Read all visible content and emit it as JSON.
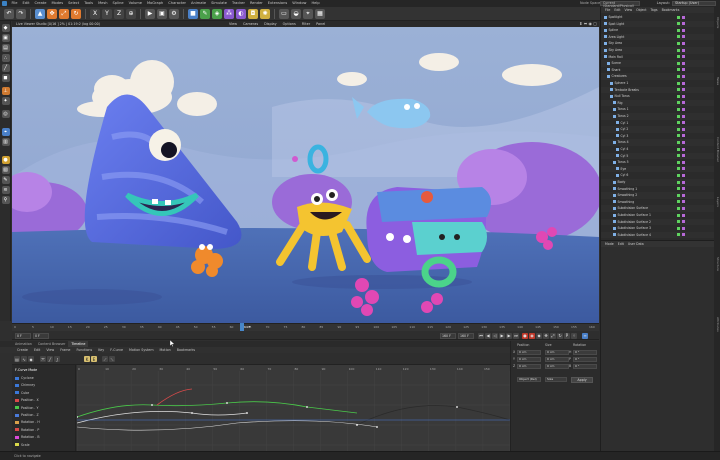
{
  "menubar": {
    "items": [
      "File",
      "Edit",
      "Create",
      "Modes",
      "Select",
      "Tools",
      "Mesh",
      "Spline",
      "Volume",
      "MoGraph",
      "Character",
      "Animate",
      "Simulate",
      "Tracker",
      "Render",
      "Extensions",
      "Window",
      "Help"
    ],
    "node_space_label": "Node Space:",
    "node_space_value": "Current (Standard/Physical)",
    "layout_label": "Layout:",
    "layout_value": "Startup (User)"
  },
  "viewport": {
    "title": "Live Viewer Studio [0/16 ] 2% | 01:19:2 (log 00:00)",
    "menu": [
      "View",
      "Cameras",
      "Display",
      "Options",
      "Filter",
      "Panel"
    ],
    "icons": "⬍ ⬌ ◉ ▢"
  },
  "ruler": {
    "ticks": [
      "0",
      "5",
      "10",
      "15",
      "20",
      "25",
      "30",
      "35",
      "40",
      "45",
      "50",
      "55",
      "60",
      "65",
      "70",
      "75",
      "80",
      "85",
      "90",
      "95",
      "100",
      "105",
      "110",
      "115",
      "120",
      "125",
      "130",
      "135",
      "140",
      "145",
      "150",
      "155",
      "160"
    ],
    "current_frame": "64 F"
  },
  "transport": {
    "start": "0 F",
    "end": "160 F",
    "range_end": "160 F",
    "current": "0 F"
  },
  "timeline": {
    "tabs": [
      "Animation",
      "Content Browser",
      "Timeline"
    ],
    "menu": [
      "Create",
      "Edit",
      "View",
      "Frame",
      "Functions",
      "Key",
      "F-Curve",
      "Motion System",
      "Motion",
      "Bookmarks"
    ],
    "mode_label": "F-Curve Mode",
    "tree": [
      {
        "label": "Cyclone",
        "color": "#3b78d8"
      },
      {
        "label": "Chimney",
        "color": "#3b78d8"
      },
      {
        "label": "Cube",
        "color": "#3b78d8"
      },
      {
        "label": "Position . X",
        "color": "#d94a4a"
      },
      {
        "label": "Position . Y",
        "color": "#4ac94a"
      },
      {
        "label": "Position . Z",
        "color": "#4a7ad9"
      },
      {
        "label": "Rotation . H",
        "color": "#d9a04a"
      },
      {
        "label": "Rotation . P",
        "color": "#d94a4a"
      },
      {
        "label": "Rotation . B",
        "color": "#d94ad9"
      },
      {
        "label": "Scale",
        "color": "#d9d94a"
      }
    ],
    "graph_ticks": [
      "0",
      "10",
      "20",
      "30",
      "40",
      "50",
      "60",
      "70",
      "80",
      "90",
      "100",
      "110",
      "120",
      "130",
      "140",
      "150",
      "160"
    ]
  },
  "status": {
    "text": "Click to navigate"
  },
  "coords": {
    "headers": [
      "Position",
      "Size",
      "Rotation"
    ],
    "rows": [
      {
        "axis": "X",
        "pos": "0 cm",
        "size": "0 cm",
        "rot_axis": "H",
        "rot": "0 °"
      },
      {
        "axis": "Y",
        "pos": "0 cm",
        "size": "0 cm",
        "rot_axis": "P",
        "rot": "0 °"
      },
      {
        "axis": "Z",
        "pos": "0 cm",
        "size": "0 cm",
        "rot_axis": "B",
        "rot": "0 °"
      }
    ],
    "mode": "Object (Rel)",
    "size_mode": "Size",
    "apply": "Apply"
  },
  "object_manager": {
    "menu": [
      "File",
      "Edit",
      "View",
      "Object",
      "Tags",
      "Bookmarks"
    ],
    "rows": [
      {
        "label": "Spotlight",
        "indent": 0
      },
      {
        "label": "Spot Light",
        "indent": 0
      },
      {
        "label": "Spline",
        "indent": 0
      },
      {
        "label": "Area Light",
        "indent": 0
      },
      {
        "label": "Sky Area",
        "indent": 0
      },
      {
        "label": "Sky Area",
        "indent": 0
      },
      {
        "label": "Main Rail",
        "indent": 0
      },
      {
        "label": "Scene",
        "indent": 1
      },
      {
        "label": "Shark",
        "indent": 1
      },
      {
        "label": "Creatures",
        "indent": 1
      },
      {
        "label": "Sphere 1",
        "indent": 2
      },
      {
        "label": "Tentacle Breaks",
        "indent": 2
      },
      {
        "label": "Null Torus",
        "indent": 2
      },
      {
        "label": "Rig",
        "indent": 3
      },
      {
        "label": "Torus 1",
        "indent": 3
      },
      {
        "label": "Torus 2",
        "indent": 3
      },
      {
        "label": "Cyl 1",
        "indent": 4
      },
      {
        "label": "Cyl 2",
        "indent": 4
      },
      {
        "label": "Cyl 3",
        "indent": 4
      },
      {
        "label": "Torus 4",
        "indent": 3
      },
      {
        "label": "Cyl 4",
        "indent": 4
      },
      {
        "label": "Cyl 5",
        "indent": 4
      },
      {
        "label": "Torus 5",
        "indent": 3
      },
      {
        "label": "Eye",
        "indent": 4
      },
      {
        "label": "Cyl 6",
        "indent": 4
      },
      {
        "label": "Body",
        "indent": 3
      },
      {
        "label": "Smoothing 1",
        "indent": 3
      },
      {
        "label": "Smoothing 2",
        "indent": 3
      },
      {
        "label": "Smoothing",
        "indent": 3
      },
      {
        "label": "Subdivision Surface",
        "indent": 3
      },
      {
        "label": "Subdivision Surface 1",
        "indent": 3
      },
      {
        "label": "Subdivision Surface 2",
        "indent": 3
      },
      {
        "label": "Subdivision Surface 3",
        "indent": 3
      },
      {
        "label": "Subdivision Surface 4",
        "indent": 3
      }
    ]
  },
  "attribute_manager": {
    "menu": [
      "Mode",
      "Edit",
      "User Data"
    ]
  },
  "side_tabs": [
    "Objects",
    "Takes",
    "Content Browser",
    "Layers",
    "Structure",
    "Attributes"
  ]
}
